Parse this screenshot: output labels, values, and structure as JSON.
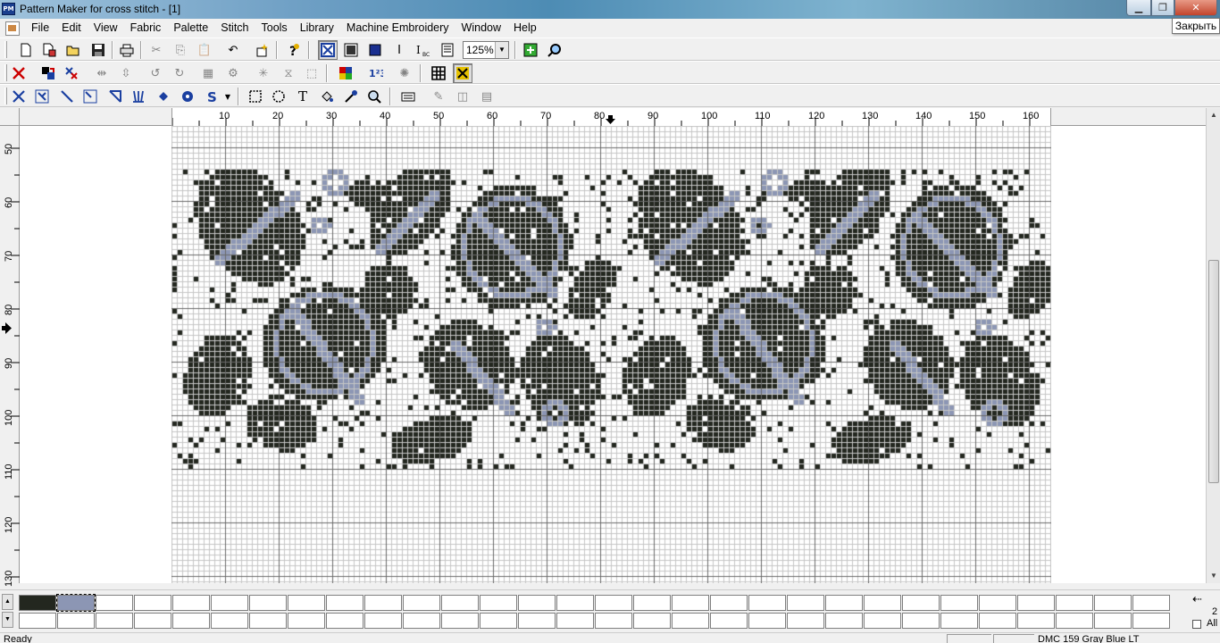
{
  "window": {
    "title": "Pattern Maker for cross stitch - [1]",
    "app_icon_text": "PM",
    "tooltip": "Закрыть"
  },
  "menu": [
    "File",
    "Edit",
    "View",
    "Fabric",
    "Palette",
    "Stitch",
    "Tools",
    "Library",
    "Machine Embroidery",
    "Window",
    "Help"
  ],
  "toolbar": {
    "zoom_value": "125%"
  },
  "rulers": {
    "horizontal": [
      "10",
      "20",
      "30",
      "40",
      "50",
      "60",
      "70",
      "80",
      "90",
      "100",
      "110",
      "120",
      "130",
      "140",
      "150",
      "160"
    ],
    "vertical": [
      "50",
      "60",
      "70",
      "80",
      "90",
      "100",
      "110",
      "120",
      "130"
    ]
  },
  "pattern_colors": {
    "fabric": "#ffffff",
    "dark": "#23271f",
    "blue": "#8c96b4",
    "grid_minor": "#c6c6c6",
    "grid_major": "#6a6a6a"
  },
  "palette": {
    "swatch_1": "#23271f",
    "swatch_2": "#8c96b4",
    "right_number": "2",
    "all_label": "All"
  },
  "status": {
    "ready": "Ready",
    "color_name": "DMC  159  Gray Blue LT"
  }
}
